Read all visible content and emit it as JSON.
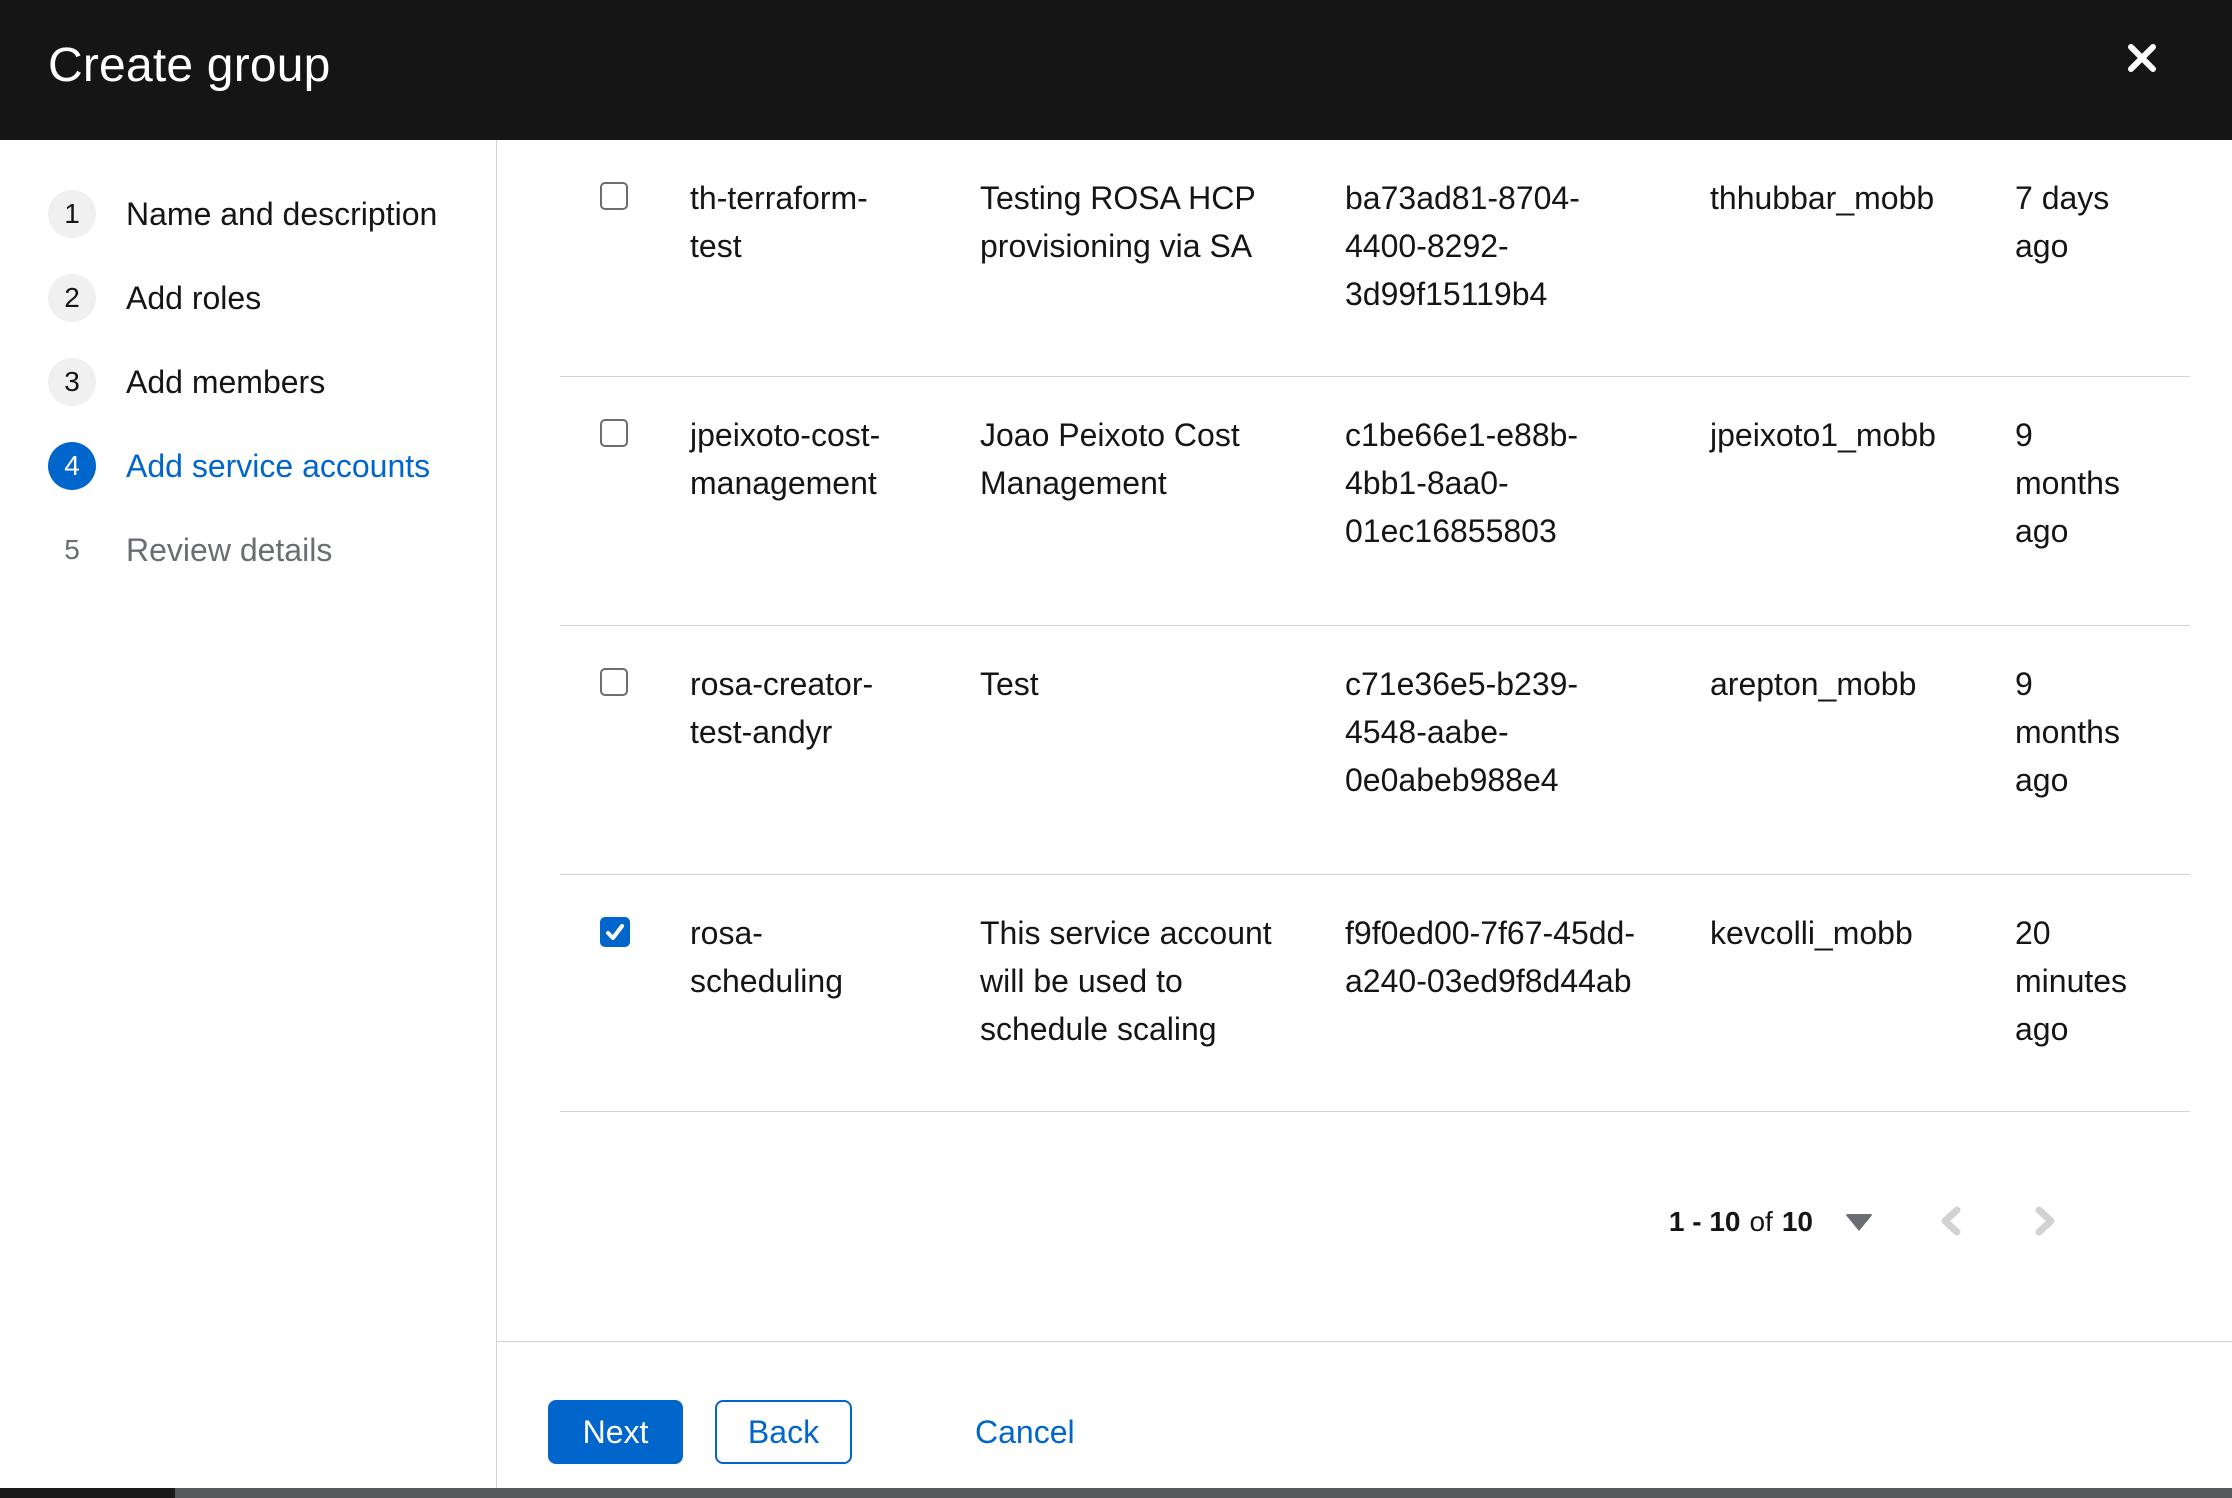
{
  "colors": {
    "accent": "#0066cc",
    "header_bg": "#151515",
    "text": "#151515",
    "muted": "#6a6e73",
    "border": "#d2d2d2",
    "disabled": "#d2d2d2",
    "circle_bg": "#f0f0f0",
    "scrollbar_track": "#58595c",
    "scrollbar_thumb": "#1a1a1a"
  },
  "modal": {
    "title": "Create group",
    "close_icon": "close-icon"
  },
  "wizard": {
    "steps": [
      {
        "number": "1",
        "label": "Name and description",
        "state": "default"
      },
      {
        "number": "2",
        "label": "Add roles",
        "state": "default"
      },
      {
        "number": "3",
        "label": "Add members",
        "state": "default"
      },
      {
        "number": "4",
        "label": "Add service accounts",
        "state": "current"
      },
      {
        "number": "5",
        "label": "Review details",
        "state": "future"
      }
    ]
  },
  "table": {
    "rows": [
      {
        "checked": false,
        "name": "th-terraform-test",
        "description": "Testing ROSA HCP provisioning via SA",
        "client_id": "ba73ad81-8704-4400-8292-3d99f15119b4",
        "owner": "thhubbar_mobb",
        "time_created": "7 days ago"
      },
      {
        "checked": false,
        "name": "jpeixoto-cost-management",
        "description": "Joao Peixoto Cost Management",
        "client_id": "c1be66e1-e88b-4bb1-8aa0-01ec16855803",
        "owner": "jpeixoto1_mobb",
        "time_created": "9 months ago"
      },
      {
        "checked": false,
        "name": "rosa-creator-test-andyr",
        "description": "Test",
        "client_id": "c71e36e5-b239-4548-aabe-0e0abeb988e4",
        "owner": "arepton_mobb",
        "time_created": "9 months ago"
      },
      {
        "checked": true,
        "name": "rosa-scheduling",
        "description": "This service account will be used to schedule scaling",
        "client_id": "f9f0ed00-7f67-45dd-a240-03ed9f8d44ab",
        "owner": "kevcolli_mobb",
        "time_created": "20 minutes ago"
      }
    ]
  },
  "pagination": {
    "range": "1 - 10",
    "of_label": "of",
    "total": "10",
    "caret_icon": "caret-down-icon",
    "prev_icon": "chevron-left-icon",
    "next_icon": "chevron-right-icon"
  },
  "footer": {
    "next_label": "Next",
    "back_label": "Back",
    "cancel_label": "Cancel"
  }
}
